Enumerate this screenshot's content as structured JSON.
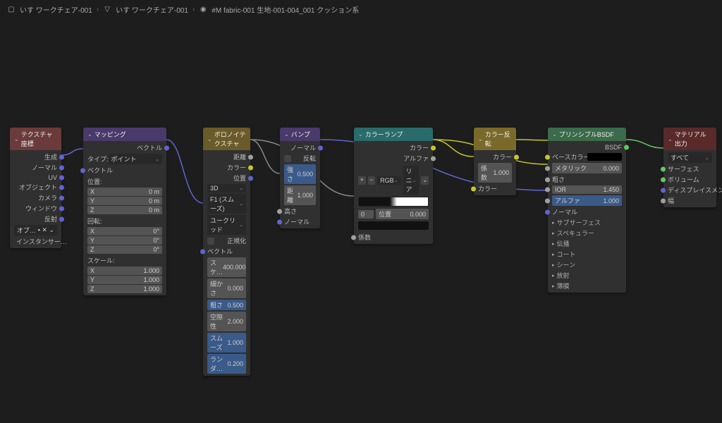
{
  "breadcrumb": [
    {
      "icon": "object",
      "label": "いす ワークチェア-001"
    },
    {
      "icon": "mesh",
      "label": "いす ワークチェア-001"
    },
    {
      "icon": "material",
      "label": "#M fabric-001 生地-001-004_001 クッション系"
    }
  ],
  "nodes": {
    "texcoord": {
      "title": "テクスチャ座標",
      "outputs": [
        "生成",
        "ノーマル",
        "UV",
        "オブジェクト",
        "カメラ",
        "ウィンドウ",
        "反射"
      ],
      "object_label": "オブ…",
      "instancer_label": "インスタンサー…"
    },
    "mapping": {
      "title": "マッピング",
      "out_vector": "ベクトル",
      "type_label": "タイプ:",
      "type_value": "ポイント",
      "in_vector": "ベクトル",
      "loc_label": "位置:",
      "rot_label": "回転:",
      "scale_label": "スケール:",
      "xyz": [
        "X",
        "Y",
        "Z"
      ],
      "loc_vals": [
        "0 m",
        "0 m",
        "0 m"
      ],
      "rot_vals": [
        "0°",
        "0°",
        "0°"
      ],
      "scale_vals": [
        "1.000",
        "1.000",
        "1.000"
      ]
    },
    "voronoi": {
      "title": "ボロノイテクスチャ",
      "out_distance": "距離",
      "out_color": "カラー",
      "out_position": "位置",
      "dim": "3D",
      "feature": "F1 (スムーズ)",
      "metric": "ユークリッド",
      "normalize": "正規化",
      "in_vector": "ベクトル",
      "scale_label": "スケ…",
      "scale_val": "400.000",
      "detail_label": "細かさ",
      "detail_val": "0.000",
      "rough_label": "粗さ",
      "rough_val": "0.500",
      "lacun_label": "空隙性",
      "lacun_val": "2.000",
      "smooth_label": "スムーズ",
      "smooth_val": "1.000",
      "random_label": "ランダ…",
      "random_val": "0.200"
    },
    "bump": {
      "title": "バンプ",
      "out_normal": "ノーマル",
      "invert": "反転",
      "strength_label": "強さ",
      "strength_val": "0.500",
      "distance_label": "距離",
      "distance_val": "1.000",
      "height": "高さ",
      "in_normal": "ノーマル"
    },
    "colorramp": {
      "title": "カラーランプ",
      "out_color": "カラー",
      "out_alpha": "アルファ",
      "interp": "リニア",
      "mode": "RGB",
      "pos_label": "位置",
      "pos_val": "0.000",
      "index": "0",
      "in_fac": "係数"
    },
    "invert": {
      "title": "カラー反転",
      "out_color": "カラー",
      "fac_label": "係数",
      "fac_val": "1.000",
      "in_color": "カラー"
    },
    "bsdf": {
      "title": "プリンシプルBSDF",
      "out_bsdf": "BSDF",
      "base_color": "ベースカラー",
      "metallic_label": "メタリック",
      "metallic_val": "0.000",
      "rough_label": "粗さ",
      "ior_label": "IOR",
      "ior_val": "1.450",
      "alpha_label": "アルファ",
      "alpha_val": "1.000",
      "normal": "ノーマル",
      "sections": [
        "サブサーフェス",
        "スペキュラー",
        "伝播",
        "コート",
        "シーン",
        "放射",
        "薄膜"
      ]
    },
    "output": {
      "title": "マテリアル出力",
      "target": "すべて",
      "surface": "サーフェス",
      "volume": "ボリューム",
      "displacement": "ディスプレイスメント",
      "thickness": "幅"
    }
  }
}
